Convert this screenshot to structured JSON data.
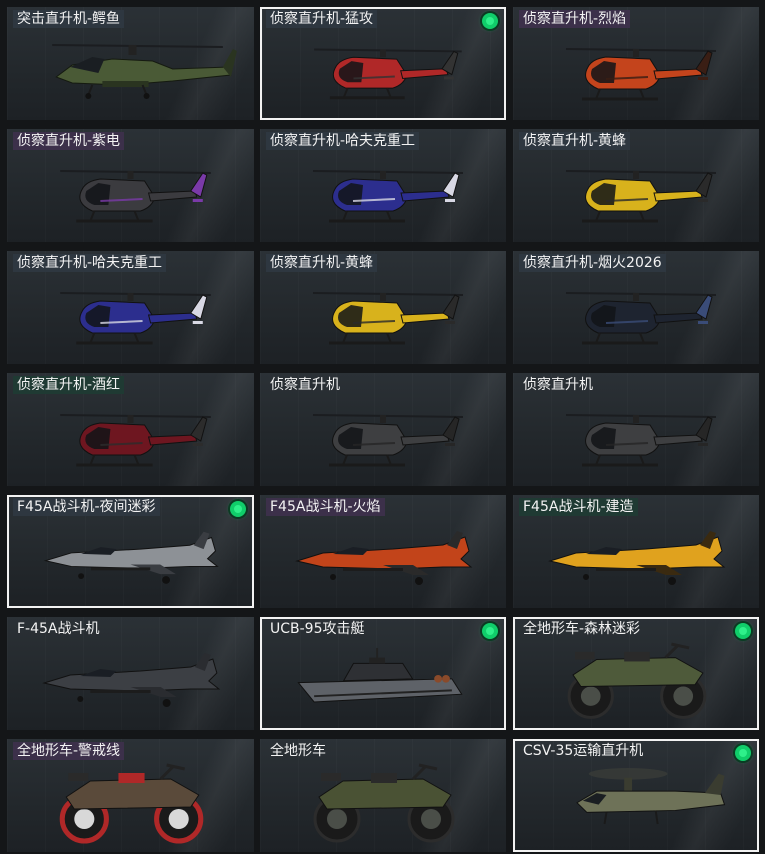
{
  "colors": {
    "badge": "#10ce6a",
    "selected_border": "#f2f2f2",
    "label_bg_default": "#2e3740",
    "label_bg_purple": "#3c304a",
    "label_bg_green": "#1f3a33"
  },
  "items": [
    {
      "name": "突击直升机-鳄鱼",
      "kind": "attack-heli",
      "color": "#4a5a36",
      "accent": "#2a3420",
      "equipped": false,
      "label_bg": "#2e3740"
    },
    {
      "name": "侦察直升机-猛攻",
      "kind": "scout-heli",
      "color": "#b02828",
      "accent": "#333333",
      "equipped": true,
      "label_bg": "#2e3740"
    },
    {
      "name": "侦察直升机-烈焰",
      "kind": "scout-heli",
      "color": "#c4441c",
      "accent": "#3a1e14",
      "equipped": false,
      "label_bg": "#3c304a"
    },
    {
      "name": "侦察直升机-紫电",
      "kind": "scout-heli",
      "color": "#3b3b3f",
      "accent": "#7a3aa8",
      "equipped": false,
      "label_bg": "#3c304a"
    },
    {
      "name": "侦察直升机-哈夫克重工",
      "kind": "scout-heli",
      "color": "#2c2e8e",
      "accent": "#d8d8e4",
      "equipped": false,
      "label_bg": "#2e3740"
    },
    {
      "name": "侦察直升机-黄蜂",
      "kind": "scout-heli",
      "color": "#d8b21c",
      "accent": "#2a2a2a",
      "equipped": false,
      "label_bg": "#2e3740"
    },
    {
      "name": "侦察直升机-哈夫克重工",
      "kind": "scout-heli",
      "color": "#2c2e8e",
      "accent": "#d8d8e4",
      "equipped": false,
      "label_bg": "#2e3740"
    },
    {
      "name": "侦察直升机-黄蜂",
      "kind": "scout-heli",
      "color": "#d8b21c",
      "accent": "#2a2a2a",
      "equipped": false,
      "label_bg": "#2e3740"
    },
    {
      "name": "侦察直升机-烟火2026",
      "kind": "scout-heli",
      "color": "#1e2430",
      "accent": "#3a4c78",
      "equipped": false,
      "label_bg": "#2e3740"
    },
    {
      "name": "侦察直升机-酒红",
      "kind": "scout-heli",
      "color": "#6e1620",
      "accent": "#2c2c2c",
      "equipped": false,
      "label_bg": "#1f3a33"
    },
    {
      "name": "侦察直升机",
      "kind": "scout-heli",
      "color": "#3e3f41",
      "accent": "#262626",
      "equipped": false,
      "label_bg": ""
    },
    {
      "name": "侦察直升机",
      "kind": "scout-heli",
      "color": "#3e3f41",
      "accent": "#262626",
      "equipped": false,
      "label_bg": ""
    },
    {
      "name": "F45A战斗机-夜间迷彩",
      "kind": "jet",
      "color": "#8d9196",
      "accent": "#3a3d42",
      "equipped": true,
      "label_bg": "#2e3740"
    },
    {
      "name": "F45A战斗机-火焰",
      "kind": "jet",
      "color": "#c2441a",
      "accent": "#2a2a2a",
      "equipped": false,
      "label_bg": "#3c304a"
    },
    {
      "name": "F45A战斗机-建造",
      "kind": "jet",
      "color": "#e0a21e",
      "accent": "#3a2a10",
      "equipped": false,
      "label_bg": "#1f3a33"
    },
    {
      "name": "F-45A战斗机",
      "kind": "jet",
      "color": "#3c3f44",
      "accent": "#2a2c30",
      "equipped": false,
      "label_bg": ""
    },
    {
      "name": "UCB-95攻击艇",
      "kind": "boat",
      "color": "#5e6268",
      "accent": "#2e3034",
      "equipped": true,
      "label_bg": ""
    },
    {
      "name": "全地形车-森林迷彩",
      "kind": "atv",
      "color": "#4e5a3a",
      "accent": "#2a2a2a",
      "equipped": true,
      "label_bg": ""
    },
    {
      "name": "全地形车-警戒线",
      "kind": "atv-red",
      "color": "#5a4a3a",
      "accent": "#b02828",
      "equipped": false,
      "label_bg": "#3c304a"
    },
    {
      "name": "全地形车",
      "kind": "atv",
      "color": "#4a5234",
      "accent": "#2a2a2a",
      "equipped": false,
      "label_bg": ""
    },
    {
      "name": "CSV-35运输直升机",
      "kind": "tiltrotor",
      "color": "#6e7258",
      "accent": "#3a3c30",
      "equipped": true,
      "label_bg": ""
    }
  ]
}
